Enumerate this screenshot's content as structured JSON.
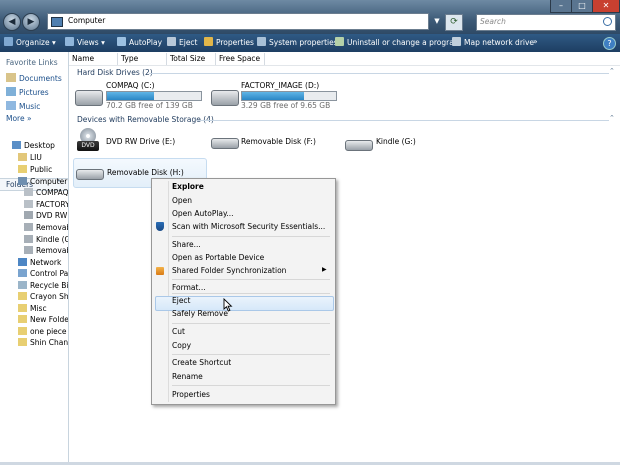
{
  "window": {
    "back_glyph": "◀",
    "forward_glyph": "▶",
    "address_path": "Computer",
    "search_placeholder": "Search",
    "minimize": "–",
    "maximize": "□",
    "close": "✕"
  },
  "toolbar": {
    "organize": "Organize",
    "views": "Views",
    "autoplay": "AutoPlay",
    "eject": "Eject",
    "properties": "Properties",
    "system_properties": "System properties",
    "uninstall": "Uninstall or change a program",
    "map_drive": "Map network drive",
    "more": "»"
  },
  "sidebar": {
    "favorite_links_title": "Favorite Links",
    "favorites": [
      "Documents",
      "Pictures",
      "Music"
    ],
    "more": "More",
    "folders_title": "Folders",
    "tree": [
      "Desktop",
      "LIU",
      "Public",
      "Computer",
      "COMPAQ",
      "FACTORY",
      "DVD RW I",
      "Removab",
      "Kindle (G",
      "Removab",
      "Network",
      "Control Pa",
      "Recycle Bin",
      "Crayon Shi",
      "Misc",
      "New Folder",
      "one piece",
      "Shin Chan"
    ]
  },
  "columns": [
    "Name",
    "Type",
    "Total Size",
    "Free Space"
  ],
  "groups": {
    "hdd": "Hard Disk Drives (2)",
    "removable": "Devices with Removable Storage (4)"
  },
  "drives": {
    "c": {
      "name": "COMPAQ (C:)",
      "free": "70.2 GB free of 139 GB",
      "used_fraction": 0.5
    },
    "d": {
      "name": "FACTORY_IMAGE (D:)",
      "free": "3.29 GB free of 9.65 GB",
      "used_fraction": 0.66
    },
    "e": {
      "name": "DVD RW Drive (E:)",
      "badge": "DVD"
    },
    "f": {
      "name": "Removable Disk (F:)"
    },
    "g": {
      "name": "Kindle (G:)"
    },
    "h": {
      "name": "Removable Disk (H:)"
    }
  },
  "context_menu": [
    "Explore",
    "Open",
    "Open AutoPlay...",
    "Scan with Microsoft Security Essentials...",
    "Share...",
    "Open as Portable Device",
    "Shared Folder Synchronization",
    "Format...",
    "Eject",
    "Safely Remove",
    "Cut",
    "Copy",
    "Create Shortcut",
    "Rename",
    "Properties"
  ],
  "colors": {
    "accent": "#2a86c5",
    "toolbar": "#1e3e62",
    "menu_highlight": "#d6e8f9"
  }
}
